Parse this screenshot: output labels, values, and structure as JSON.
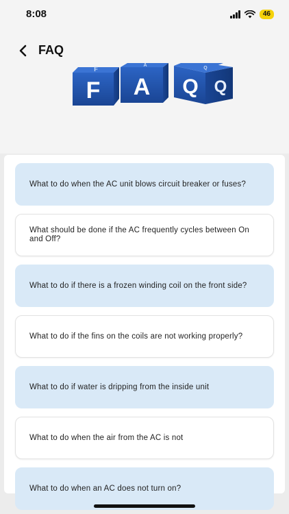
{
  "status_bar": {
    "time": "8:08",
    "battery": "46",
    "battery_color": "#f5d20a"
  },
  "header": {
    "back_icon": "chevron-left-icon",
    "title": "FAQ",
    "logo_letters": [
      "F",
      "A",
      "Q",
      "Q"
    ],
    "logo_top_letters": [
      "F",
      "A",
      "Q"
    ],
    "logo_color": "#1f4fa8"
  },
  "faq": {
    "accent_color": "#d9e9f7",
    "items": [
      {
        "question": "What to do when the AC unit blows circuit breaker or fuses?"
      },
      {
        "question": "What should be done if the AC frequently cycles between On and Off?"
      },
      {
        "question": "What to do if there is a frozen winding coil on the front side?"
      },
      {
        "question": "What to do if the fins on the coils are not working properly?"
      },
      {
        "question": "What to do if water is dripping from the inside unit"
      },
      {
        "question": "What to do when the air from the AC is not"
      },
      {
        "question": "What to do when an AC does not turn on?"
      }
    ]
  }
}
